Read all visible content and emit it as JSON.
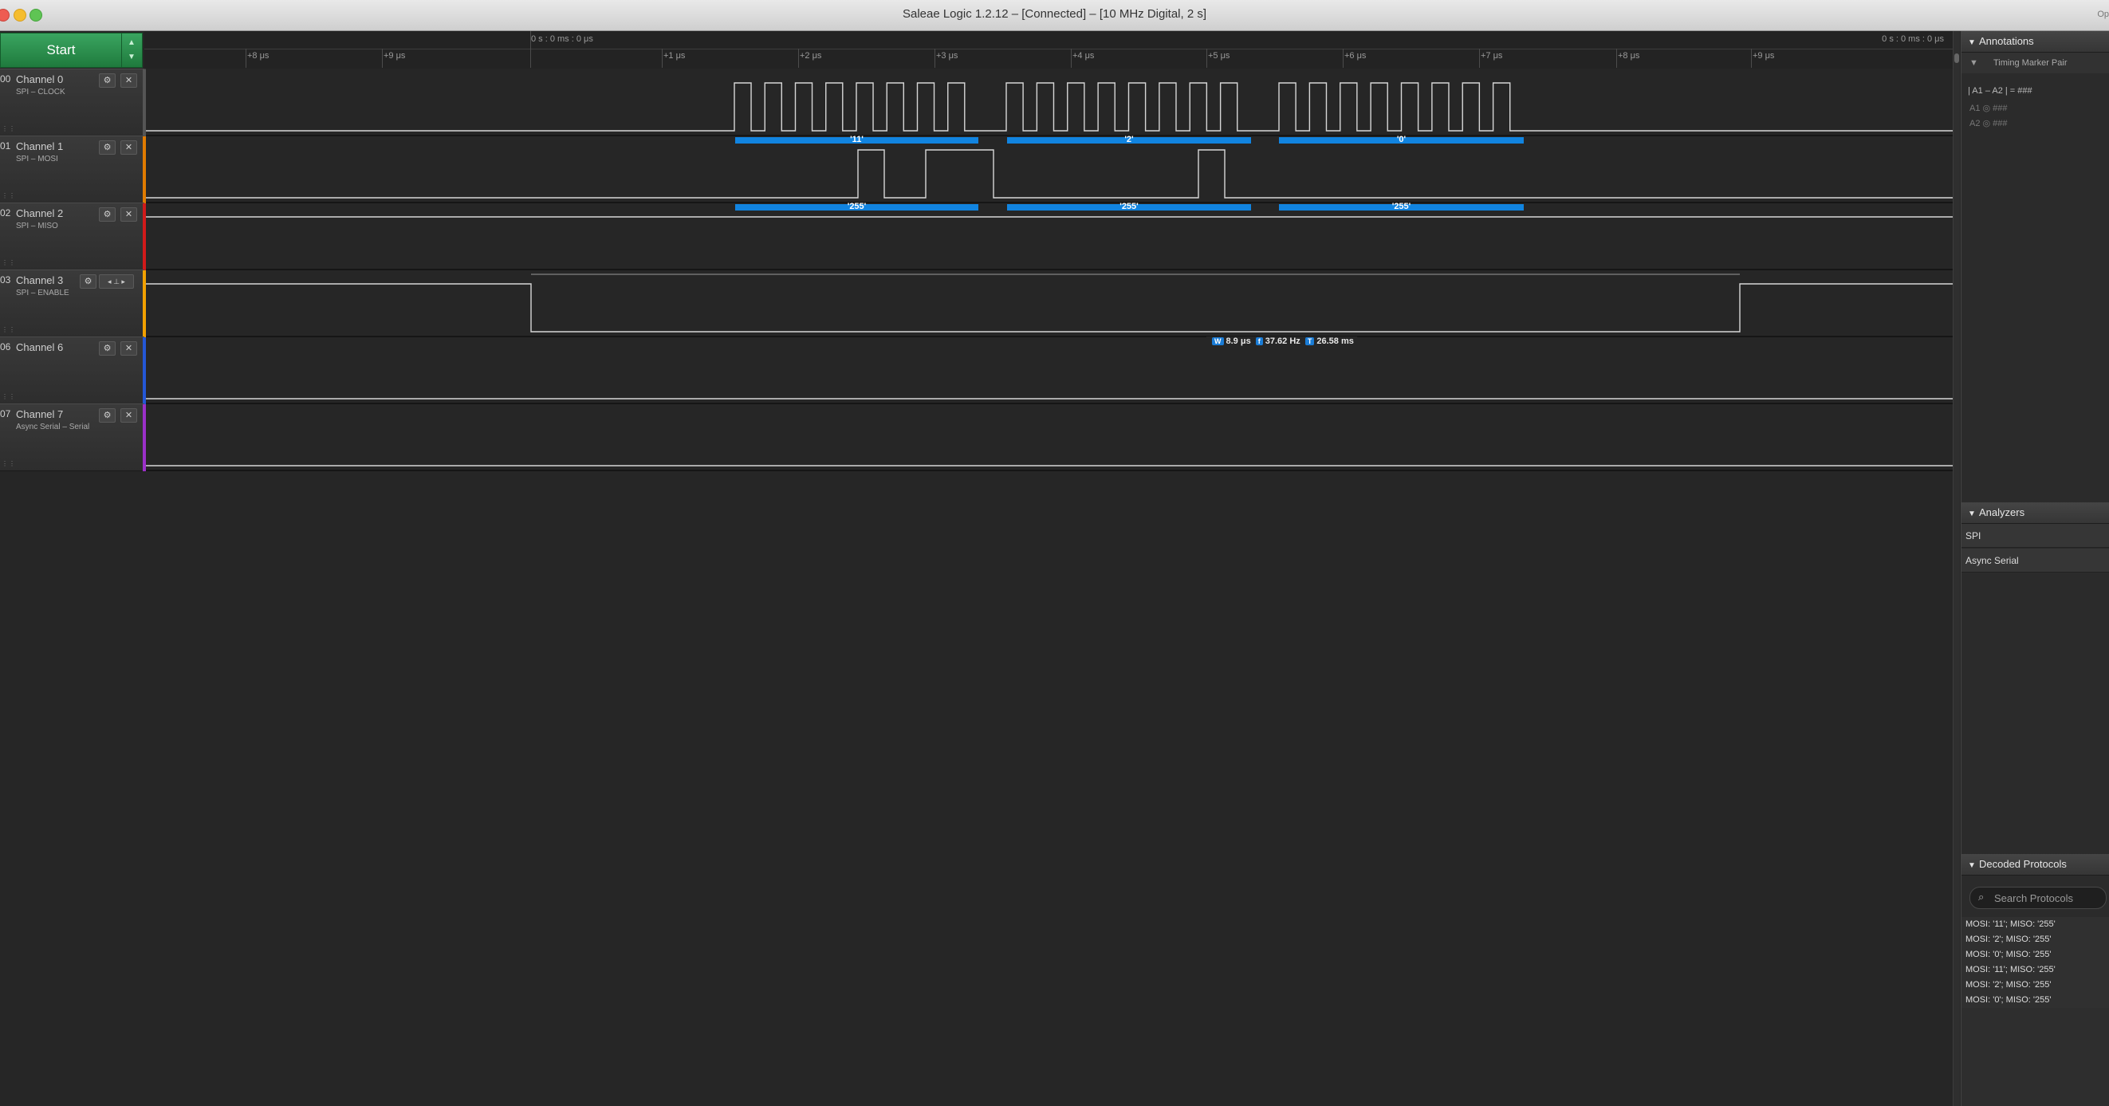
{
  "window": {
    "title": "Saleae Logic 1.2.12 – [Connected] – [10 MHz Digital, 2 s]",
    "right_fragment": "Op"
  },
  "toolbar": {
    "start_label": "Start"
  },
  "channels": [
    {
      "num": "00",
      "name": "Channel 0",
      "sub": "SPI – CLOCK",
      "color": "#555555"
    },
    {
      "num": "01",
      "name": "Channel 1",
      "sub": "SPI – MOSI",
      "color": "#e07b00"
    },
    {
      "num": "02",
      "name": "Channel 2",
      "sub": "SPI – MISO",
      "color": "#d11a1a"
    },
    {
      "num": "03",
      "name": "Channel 3",
      "sub": "SPI – ENABLE",
      "color": "#f2a100"
    },
    {
      "num": "06",
      "name": "Channel 6",
      "sub": "",
      "color": "#2457d6"
    },
    {
      "num": "07",
      "name": "Channel 7",
      "sub": "Async Serial – Serial",
      "color": "#9b30c9"
    }
  ],
  "ruler": {
    "center_label": "0 s : 0 ms : 0 μs",
    "right_label": "0 s : 0 ms : 0 μs",
    "ticks": [
      "+8 μs",
      "+9 μs",
      "+1 μs",
      "+2 μs",
      "+3 μs",
      "+4 μs",
      "+5 μs",
      "+6 μs",
      "+7 μs",
      "+8 μs",
      "+9 μs"
    ]
  },
  "decoded_bubbles": {
    "mosi": [
      "'11'",
      "'2'",
      "'0'"
    ],
    "miso": [
      "'255'",
      "'255'",
      "'255'"
    ]
  },
  "measurement": {
    "w_badge": "W",
    "width": "8.9 μs",
    "f_badge": "f",
    "freq": "37.62 Hz",
    "t_badge": "T",
    "period": "26.58 ms"
  },
  "annotations": {
    "header": "Annotations",
    "marker_pair": "Timing Marker Pair",
    "formula": "| A1 – A2 | = ###",
    "a1": "A1 ◎ ###",
    "a2": "A2 ◎ ###"
  },
  "analyzers": {
    "header": "Analyzers",
    "items": [
      "SPI",
      "Async Serial"
    ]
  },
  "decoded_protocols": {
    "header": "Decoded Protocols",
    "search_placeholder": "Search Protocols",
    "rows": [
      "MOSI: '11';  MISO: '255'",
      "MOSI: '2';  MISO: '255'",
      "MOSI: '0';  MISO: '255'",
      "MOSI: '11';  MISO: '255'",
      "MOSI: '2';  MISO: '255'",
      "MOSI: '0';  MISO: '255'"
    ]
  }
}
